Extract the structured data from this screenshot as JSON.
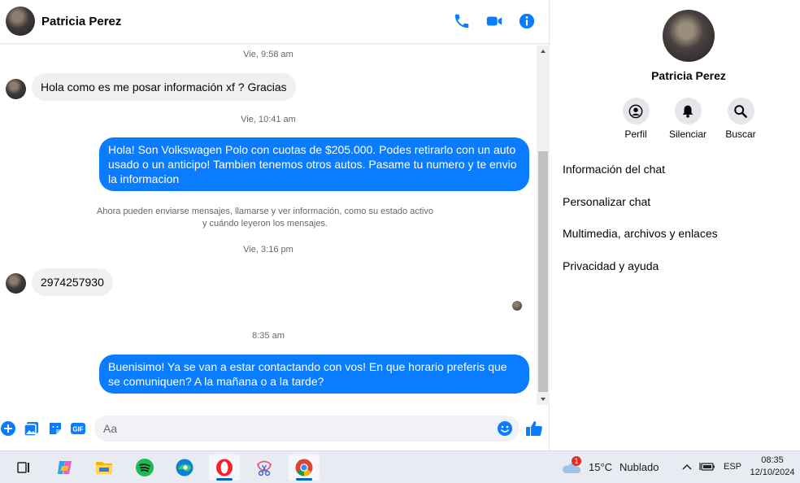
{
  "header": {
    "contact_name": "Patricia Perez"
  },
  "messages": [
    {
      "type": "timestamp",
      "text": "Vie, 9:58 am"
    },
    {
      "type": "incoming",
      "text": "Hola como es me posar información xf ? Gracias"
    },
    {
      "type": "timestamp",
      "text": "Vie, 10:41 am"
    },
    {
      "type": "outgoing",
      "text": "Hola! Son Volkswagen Polo con cuotas de $205.000. Podes retirarlo con un auto usado o un anticipo! Tambien tenemos otros autos. Pasame tu numero y te envio la informacion"
    },
    {
      "type": "notice",
      "line1": "Ahora pueden enviarse mensajes, llamarse y ver información, como su estado activo",
      "line2": "y cuándo leyeron los mensajes."
    },
    {
      "type": "timestamp",
      "text": "Vie, 3:16 pm"
    },
    {
      "type": "incoming",
      "text": "2974257930"
    },
    {
      "type": "timestamp",
      "text": "8:35 am"
    },
    {
      "type": "outgoing",
      "text": "Buenisimo! Ya se van a estar contactando con vos! En que horario preferis que se comuniquen? A la mañana o a la tarde?"
    }
  ],
  "composer": {
    "placeholder": "Aa"
  },
  "info_panel": {
    "name": "Patricia Perez",
    "actions": [
      {
        "label": "Perfil",
        "icon": "profile-icon"
      },
      {
        "label": "Silenciar",
        "icon": "bell-icon"
      },
      {
        "label": "Buscar",
        "icon": "search-icon"
      }
    ],
    "menu": [
      {
        "label": "Información del chat"
      },
      {
        "label": "Personalizar chat"
      },
      {
        "label": "Multimedia, archivos y enlaces"
      },
      {
        "label": "Privacidad y ayuda"
      }
    ]
  },
  "taskbar": {
    "weather_badge": "1",
    "temperature": "15°C",
    "weather": "Nublado",
    "language": "ESP",
    "time": "08:35",
    "date": "12/10/2024"
  },
  "colors": {
    "accent": "#0a7cff",
    "bubble_in": "#f0f0f0",
    "muted_text": "#65676b"
  }
}
